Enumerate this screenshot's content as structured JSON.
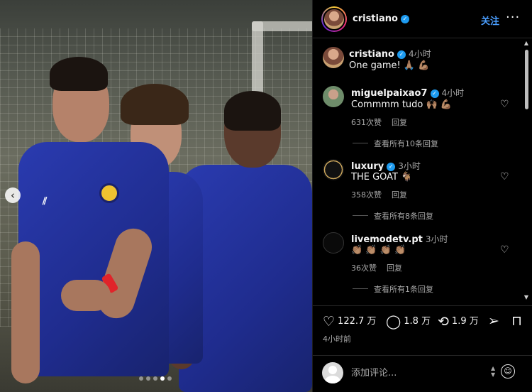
{
  "post": {
    "username": "cristiano",
    "follow_label": "关注",
    "more_label": "···"
  },
  "carousel": {
    "prev_label": "‹",
    "slide_count": 5,
    "active_index": 3
  },
  "caption": {
    "username": "cristiano",
    "time": "4小时",
    "text": "One game! 🙏🏽 💪🏽"
  },
  "comments": [
    {
      "username": "miguelpaixao7",
      "verified": true,
      "time": "4小时",
      "text": "Commmm tudo 🙌🏽 💪🏽",
      "likes": "631次赞",
      "reply_label": "回复",
      "view_replies": "查看所有10条回复"
    },
    {
      "username": "luxury",
      "verified": true,
      "time": "3小时",
      "text": "THE GOAT 🐐",
      "likes": "358次赞",
      "reply_label": "回复",
      "view_replies": "查看所有8条回复"
    },
    {
      "username": "livemodetv.pt",
      "verified": false,
      "time": "3小时",
      "text": "👏🏽 👏🏽 👏🏽 👏🏽",
      "likes": "36次赞",
      "reply_label": "回复",
      "view_replies": "查看所有1条回复"
    }
  ],
  "actions": {
    "likes": "122.7 万",
    "comments": "1.8 万",
    "reposts": "1.9 万",
    "posted_ago": "4小时前"
  },
  "composer": {
    "placeholder": "添加评论..."
  },
  "colors": {
    "accent": "#4a9eff",
    "verified": "#1d9bf0",
    "background": "#000000",
    "jersey": "#2a3bb0"
  },
  "icons": [
    "chevron-left-icon",
    "verified-icon",
    "more-icon",
    "heart-icon",
    "comment-icon",
    "repost-icon",
    "send-icon",
    "bookmark-icon",
    "emoji-icon",
    "avatar-icon"
  ]
}
